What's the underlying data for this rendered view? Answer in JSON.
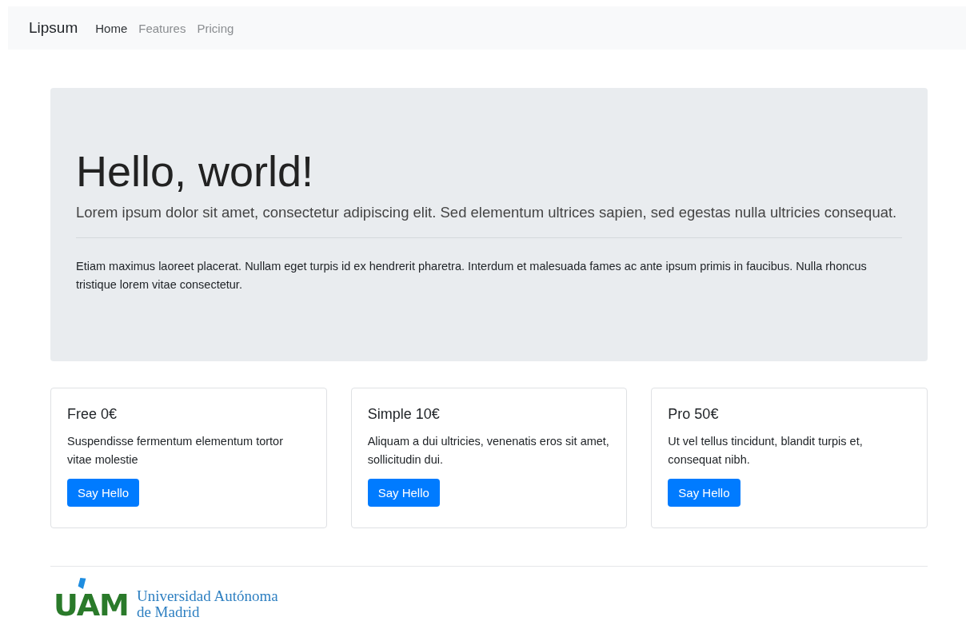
{
  "navbar": {
    "brand": "Lipsum",
    "links": [
      {
        "label": "Home",
        "selected": true
      },
      {
        "label": "Features",
        "selected": false
      },
      {
        "label": "Pricing",
        "selected": false
      }
    ]
  },
  "hero": {
    "title": "Hello, world!",
    "lead": "Lorem ipsum dolor sit amet, consectetur adipiscing elit. Sed elementum ultrices sapien, sed egestas nulla ultricies consequat.",
    "body": "Etiam maximus laoreet placerat. Nullam eget turpis id ex hendrerit pharetra. Interdum et malesuada fames ac ante ipsum primis in faucibus. Nulla rhoncus tristique lorem vitae consectetur."
  },
  "cards": [
    {
      "title": "Free 0€",
      "text": "Suspendisse fermentum elementum tortor vitae molestie",
      "button": "Say Hello"
    },
    {
      "title": "Simple 10€",
      "text": "Aliquam a dui ultricies, venenatis eros sit amet, sollicitudin dui.",
      "button": "Say Hello"
    },
    {
      "title": "Pro 50€",
      "text": "Ut vel tellus tincidunt, blandit turpis et, consequat nibh.",
      "button": "Say Hello"
    }
  ],
  "footer": {
    "logo_mark": "UAM",
    "logo_lines": [
      "Universidad Autónoma",
      "de Madrid"
    ]
  }
}
